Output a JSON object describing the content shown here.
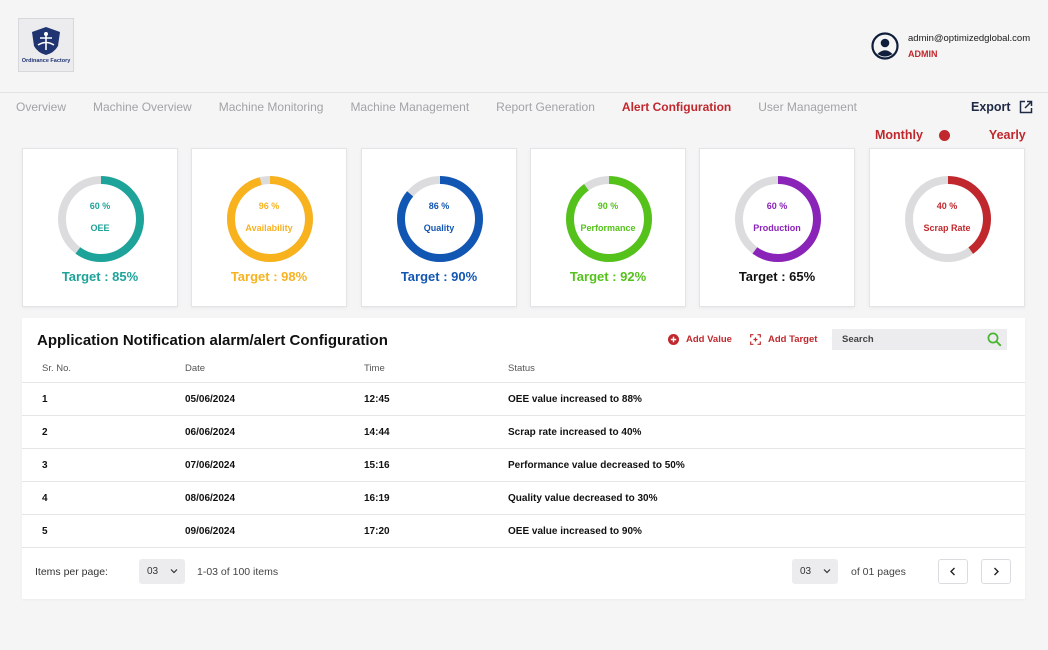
{
  "logo": {
    "text": "Ordinance Factory"
  },
  "user": {
    "email": "admin@optimizedglobal.com",
    "role": "ADMIN"
  },
  "nav": {
    "tabs": [
      "Overview",
      "Machine Overview",
      "Machine Monitoring",
      "Machine Management",
      "Report Generation",
      "Alert Configuration",
      "User Management"
    ],
    "active_index": 5
  },
  "export_label": "Export",
  "period": {
    "monthly": "Monthly",
    "yearly": "Yearly"
  },
  "gauges": [
    {
      "percent": "60 %",
      "label": "OEE",
      "target": "Target : 85%",
      "value": 0.6,
      "color": "#1ea39a",
      "target_color": "#1ea39a",
      "label_color": "#1ea39a"
    },
    {
      "percent": "96 %",
      "label": "Availability",
      "target": "Target : 98%",
      "value": 0.96,
      "color": "#f7b21e",
      "target_color": "#f7b21e",
      "label_color": "#f7b21e"
    },
    {
      "percent": "86 %",
      "label": "Quality",
      "target": "Target : 90%",
      "value": 0.86,
      "color": "#1256b3",
      "target_color": "#1256b3",
      "label_color": "#1256b3"
    },
    {
      "percent": "90 %",
      "label": "Performance",
      "target": "Target : 92%",
      "value": 0.9,
      "color": "#55c21b",
      "target_color": "#55c21b",
      "label_color": "#55c21b"
    },
    {
      "percent": "60 %",
      "label": "Production",
      "target": "Target : 65%",
      "value": 0.6,
      "color": "#8a24b8",
      "target_color": "#111111",
      "label_color": "#8a24b8"
    },
    {
      "percent": "40 %",
      "label": "Scrap Rate",
      "target": "",
      "value": 0.4,
      "color": "#c0282d",
      "target_color": "#c0282d",
      "label_color": "#c0282d"
    }
  ],
  "panel": {
    "title": "Application Notification alarm/alert Configuration",
    "add_value": "Add Value",
    "add_target": "Add Target",
    "search_placeholder": "Search",
    "columns": [
      "Sr. No.",
      "Date",
      "Time",
      "Status"
    ],
    "rows": [
      [
        "1",
        "05/06/2024",
        "12:45",
        "OEE value increased to 88%"
      ],
      [
        "2",
        "06/06/2024",
        "14:44",
        "Scrap rate increased to 40%"
      ],
      [
        "3",
        "07/06/2024",
        "15:16",
        "Performance value decreased  to 50%"
      ],
      [
        "4",
        "08/06/2024",
        "16:19",
        "Quality value decreased  to 30%"
      ],
      [
        "5",
        "09/06/2024",
        "17:20",
        "OEE value increased to 90%"
      ]
    ],
    "items_per_page_label": "Items per page:",
    "items_per_page": "03",
    "range_text": "1-03 of 100 items",
    "page": "03",
    "pages_text": "of 01 pages"
  },
  "colors": {
    "accent": "#c0282d",
    "track": "#dcdcde"
  }
}
